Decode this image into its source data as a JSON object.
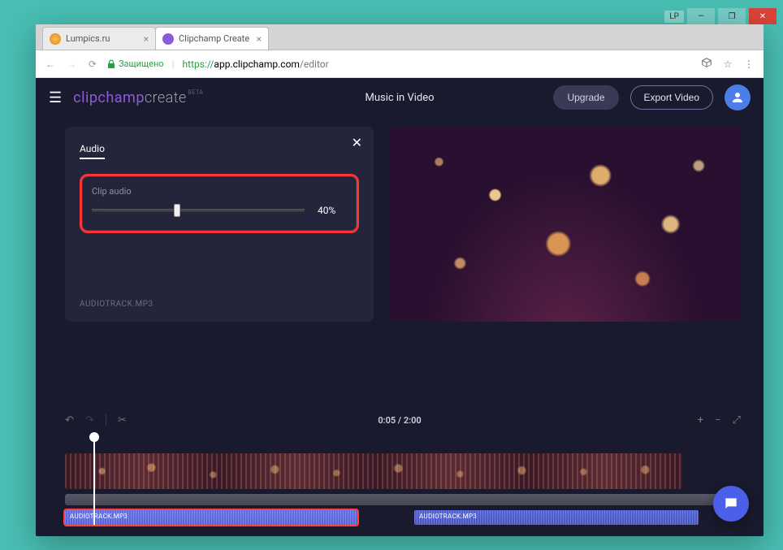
{
  "window": {
    "lp_badge": "LP",
    "minimize": "—",
    "maximize": "❐",
    "close": "✕"
  },
  "tabs": [
    {
      "title": "Lumpics.ru",
      "active": false
    },
    {
      "title": "Clipchamp Create",
      "active": true
    }
  ],
  "address": {
    "secure_label": "Защищено",
    "scheme": "https://",
    "host": "app.clipchamp.com",
    "path": "/editor"
  },
  "header": {
    "logo_left": "clipchamp",
    "logo_right": "create",
    "beta": "BETA",
    "project_title": "Music in Video",
    "upgrade": "Upgrade",
    "export": "Export Video"
  },
  "panel": {
    "tab": "Audio",
    "clip_audio_label": "Clip audio",
    "volume_percent": 40,
    "volume_display": "40%",
    "filename": "AUDIOTRACK.MP3"
  },
  "toolbar": {
    "time_current": "0:05",
    "time_total": "2:00",
    "time_display": "0:05 / 2:00"
  },
  "timeline": {
    "audio_clips": [
      {
        "label": "AUDIOTRACK.MP3",
        "selected": true
      },
      {
        "label": "AUDIOTRACK.MP3",
        "selected": false
      }
    ]
  },
  "colors": {
    "accent_purple": "#8e5bd6",
    "highlight_red": "#ff3333",
    "chat_blue": "#4c5fe8",
    "bg_dark": "#1a1a2e"
  }
}
